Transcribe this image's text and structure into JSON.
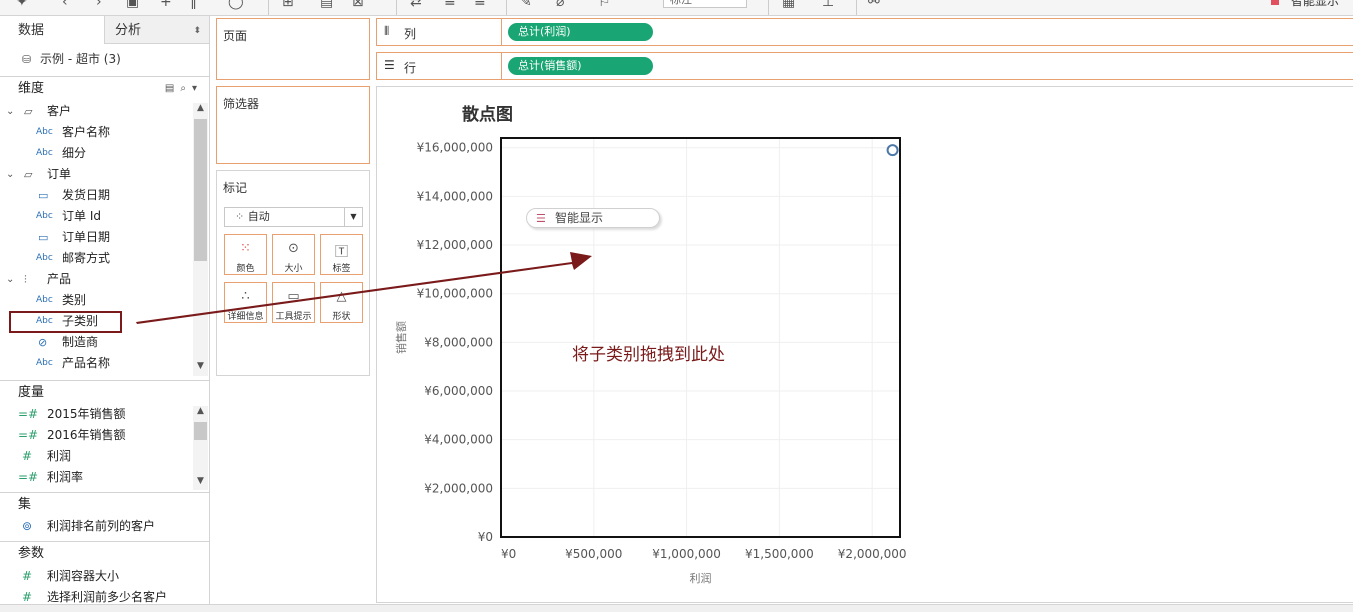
{
  "toolbar": {
    "filter_dropdown": "标注",
    "smart_show": "智能显示"
  },
  "left": {
    "tabs": [
      "数据",
      "分析"
    ],
    "datasource": "示例 - 超市 (3)",
    "dimensions_title": "维度",
    "dimensions": [
      {
        "type": "folder",
        "label": "客户"
      },
      {
        "type": "abc",
        "label": "客户名称"
      },
      {
        "type": "abc",
        "label": "细分"
      },
      {
        "type": "folder",
        "label": "订单"
      },
      {
        "type": "date",
        "label": "发货日期"
      },
      {
        "type": "abc",
        "label": "订单 Id"
      },
      {
        "type": "date",
        "label": "订单日期"
      },
      {
        "type": "abc",
        "label": "邮寄方式"
      },
      {
        "type": "hierarchy",
        "label": "产品"
      },
      {
        "type": "abc",
        "label": "类别"
      },
      {
        "type": "abc",
        "label": "子类别"
      },
      {
        "type": "clip",
        "label": "制造商"
      },
      {
        "type": "abc",
        "label": "产品名称"
      }
    ],
    "measures_title": "度量",
    "measures": [
      {
        "type": "calc",
        "label": "2015年销售额"
      },
      {
        "type": "calc",
        "label": "2016年销售额"
      },
      {
        "type": "num",
        "label": "利润"
      },
      {
        "type": "calc",
        "label": "利润率"
      }
    ],
    "sets_title": "集",
    "sets": [
      "利润排名前列的客户"
    ],
    "params_title": "参数",
    "params": [
      "利润容器大小",
      "选择利润前多少名客户"
    ]
  },
  "cards": {
    "pages": "页面",
    "filters": "筛选器",
    "marks": "标记",
    "marks_type": "自动",
    "mark_buttons": [
      "颜色",
      "大小",
      "标签",
      "详细信息",
      "工具提示",
      "形状"
    ]
  },
  "shelves": {
    "columns_label": "列",
    "rows_label": "行",
    "columns_pill": "总计(利润)",
    "rows_pill": "总计(销售额)"
  },
  "chart_data": {
    "type": "scatter",
    "title": "散点图",
    "xlabel": "利润",
    "ylabel": "销售额",
    "xlim": [
      0,
      2150000
    ],
    "ylim": [
      0,
      16400000
    ],
    "xticks": [
      "¥0",
      "¥500,000",
      "¥1,000,000",
      "¥1,500,000",
      "¥2,000,000"
    ],
    "xtick_values": [
      0,
      500000,
      1000000,
      1500000,
      2000000
    ],
    "yticks": [
      "¥0",
      "¥2,000,000",
      "¥4,000,000",
      "¥6,000,000",
      "¥8,000,000",
      "¥10,000,000",
      "¥12,000,000",
      "¥14,000,000",
      "¥16,000,000"
    ],
    "ytick_values": [
      0,
      2000000,
      4000000,
      6000000,
      8000000,
      10000000,
      12000000,
      14000000,
      16000000
    ],
    "points": [
      {
        "x": 2110000,
        "y": 15900000
      }
    ],
    "grid": true
  },
  "overlay": {
    "smart_chip": "智能显示",
    "annotation": "将子类别拖拽到此处"
  }
}
